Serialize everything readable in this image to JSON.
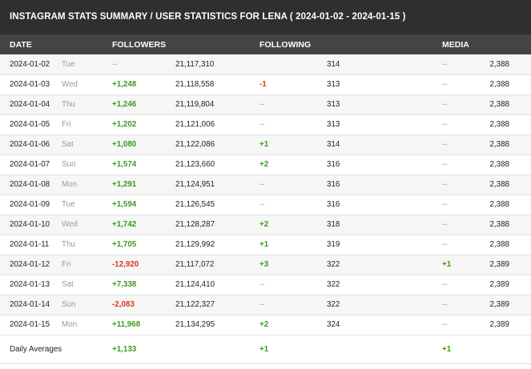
{
  "title": "INSTAGRAM STATS SUMMARY / USER STATISTICS FOR LENA ( 2024-01-02 - 2024-01-15 )",
  "headers": {
    "date": "DATE",
    "followers": "FOLLOWERS",
    "following": "FOLLOWING",
    "media": "MEDIA"
  },
  "colors": {
    "positive": "#3a9a1e",
    "negative": "#d8371a",
    "title_bg": "#2f2f2f",
    "header_bg": "#444444"
  },
  "rows": [
    {
      "date": "2024-01-02",
      "day": "Tue",
      "followers_change": "--",
      "followers": "21,117,310",
      "following_change": "",
      "following": "314",
      "media_change": "--",
      "media": "2,388"
    },
    {
      "date": "2024-01-03",
      "day": "Wed",
      "followers_change": "+1,248",
      "followers": "21,118,558",
      "following_change": "-1",
      "following": "313",
      "media_change": "--",
      "media": "2,388"
    },
    {
      "date": "2024-01-04",
      "day": "Thu",
      "followers_change": "+1,246",
      "followers": "21,119,804",
      "following_change": "--",
      "following": "313",
      "media_change": "--",
      "media": "2,388"
    },
    {
      "date": "2024-01-05",
      "day": "Fri",
      "followers_change": "+1,202",
      "followers": "21,121,006",
      "following_change": "--",
      "following": "313",
      "media_change": "--",
      "media": "2,388"
    },
    {
      "date": "2024-01-06",
      "day": "Sat",
      "followers_change": "+1,080",
      "followers": "21,122,086",
      "following_change": "+1",
      "following": "314",
      "media_change": "--",
      "media": "2,388"
    },
    {
      "date": "2024-01-07",
      "day": "Sun",
      "followers_change": "+1,574",
      "followers": "21,123,660",
      "following_change": "+2",
      "following": "316",
      "media_change": "--",
      "media": "2,388"
    },
    {
      "date": "2024-01-08",
      "day": "Mon",
      "followers_change": "+1,291",
      "followers": "21,124,951",
      "following_change": "--",
      "following": "316",
      "media_change": "--",
      "media": "2,388"
    },
    {
      "date": "2024-01-09",
      "day": "Tue",
      "followers_change": "+1,594",
      "followers": "21,126,545",
      "following_change": "--",
      "following": "316",
      "media_change": "--",
      "media": "2,388"
    },
    {
      "date": "2024-01-10",
      "day": "Wed",
      "followers_change": "+1,742",
      "followers": "21,128,287",
      "following_change": "+2",
      "following": "318",
      "media_change": "--",
      "media": "2,388"
    },
    {
      "date": "2024-01-11",
      "day": "Thu",
      "followers_change": "+1,705",
      "followers": "21,129,992",
      "following_change": "+1",
      "following": "319",
      "media_change": "--",
      "media": "2,388"
    },
    {
      "date": "2024-01-12",
      "day": "Fri",
      "followers_change": "-12,920",
      "followers": "21,117,072",
      "following_change": "+3",
      "following": "322",
      "media_change": "+1",
      "media": "2,389"
    },
    {
      "date": "2024-01-13",
      "day": "Sat",
      "followers_change": "+7,338",
      "followers": "21,124,410",
      "following_change": "--",
      "following": "322",
      "media_change": "--",
      "media": "2,389"
    },
    {
      "date": "2024-01-14",
      "day": "Sun",
      "followers_change": "-2,083",
      "followers": "21,122,327",
      "following_change": "--",
      "following": "322",
      "media_change": "--",
      "media": "2,389"
    },
    {
      "date": "2024-01-15",
      "day": "Mon",
      "followers_change": "+11,968",
      "followers": "21,134,295",
      "following_change": "+2",
      "following": "324",
      "media_change": "--",
      "media": "2,389"
    }
  ],
  "averages": {
    "label": "Daily Averages",
    "followers_change": "+1,133",
    "following_change": "+1",
    "media_change": "+1"
  }
}
